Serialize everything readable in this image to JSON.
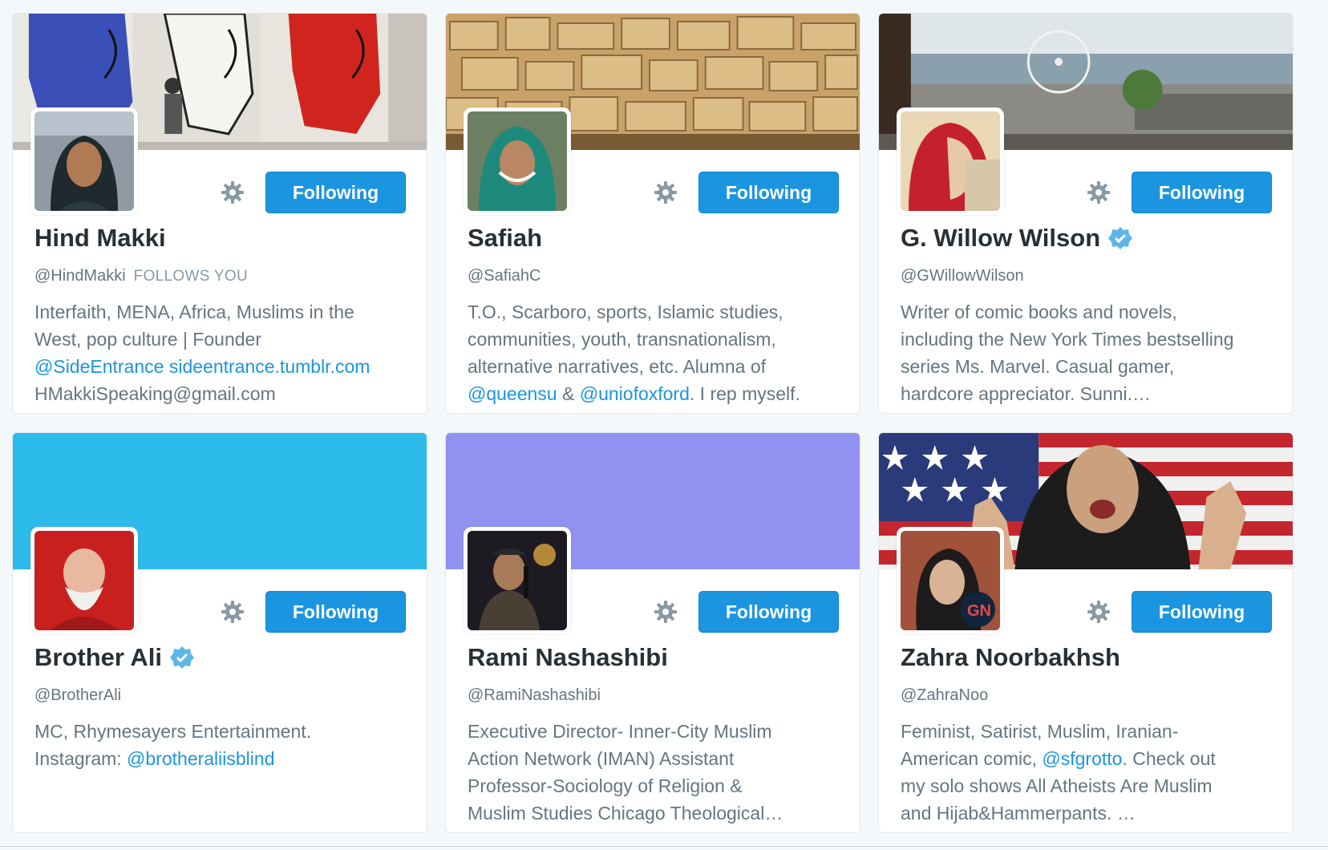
{
  "colors": {
    "accent": "#1b95e0",
    "verified": "#5eb6e8",
    "banner_brother_ali": "#2dbbeb",
    "banner_rami": "#9191f2"
  },
  "cards": [
    {
      "name": "Hind Makki",
      "handle": "@HindMakki",
      "follows_you": "FOLLOWS YOU",
      "verified": false,
      "button": "Following",
      "settings_icon": "gear-icon",
      "bio": [
        [
          {
            "t": "Interfaith, MENA, Africa, Muslims in the"
          }
        ],
        [
          {
            "t": "West, pop culture | Founder"
          }
        ],
        [
          {
            "t": "@SideEntrance",
            "link": true
          },
          {
            "t": " "
          },
          {
            "t": "sideentrance.tumblr.com",
            "link": true
          }
        ],
        [
          {
            "t": "HMakkiSpeaking@gmail.com"
          }
        ]
      ]
    },
    {
      "name": "Safiah",
      "handle": "@SafiahC",
      "verified": false,
      "button": "Following",
      "settings_icon": "gear-icon",
      "bio": [
        [
          {
            "t": "T.O., Scarboro, sports, Islamic studies,"
          }
        ],
        [
          {
            "t": "communities, youth, transnationalism,"
          }
        ],
        [
          {
            "t": "alternative narratives, etc. Alumna of"
          }
        ],
        [
          {
            "t": "@queensu",
            "link": true
          },
          {
            "t": " & "
          },
          {
            "t": "@uniofoxford",
            "link": true
          },
          {
            "t": ". I rep myself."
          }
        ]
      ]
    },
    {
      "name": "G. Willow Wilson",
      "handle": "@GWillowWilson",
      "verified": true,
      "button": "Following",
      "settings_icon": "gear-icon",
      "bio": [
        [
          {
            "t": "Writer of comic books and novels,"
          }
        ],
        [
          {
            "t": "including the New York Times bestselling"
          }
        ],
        [
          {
            "t": "series Ms. Marvel. Casual gamer,"
          }
        ],
        [
          {
            "t": "hardcore appreciator. Sunni.…"
          }
        ]
      ]
    },
    {
      "name": "Brother Ali",
      "handle": "@BrotherAli",
      "verified": true,
      "button": "Following",
      "settings_icon": "gear-icon",
      "bio": [
        [
          {
            "t": "MC, Rhymesayers Entertainment."
          }
        ],
        [
          {
            "t": "Instagram: "
          },
          {
            "t": "@brotheraliisblind",
            "link": true
          }
        ]
      ]
    },
    {
      "name": "Rami Nashashibi",
      "handle": "@RamiNashashibi",
      "verified": false,
      "button": "Following",
      "settings_icon": "gear-icon",
      "bio": [
        [
          {
            "t": "Executive Director- Inner-City Muslim"
          }
        ],
        [
          {
            "t": "Action Network (IMAN) Assistant"
          }
        ],
        [
          {
            "t": "Professor-Sociology of Religion &"
          }
        ],
        [
          {
            "t": "Muslim Studies Chicago Theological…"
          }
        ]
      ]
    },
    {
      "name": "Zahra Noorbakhsh",
      "handle": "@ZahraNoo",
      "verified": false,
      "button": "Following",
      "settings_icon": "gear-icon",
      "bio": [
        [
          {
            "t": "Feminist, Satirist, Muslim, Iranian-"
          }
        ],
        [
          {
            "t": "American comic, "
          },
          {
            "t": "@sfgrotto",
            "link": true
          },
          {
            "t": ". Check out"
          }
        ],
        [
          {
            "t": "my solo shows All Atheists Are Muslim"
          }
        ],
        [
          {
            "t": "and Hijab&Hammerpants. …"
          }
        ]
      ]
    }
  ]
}
